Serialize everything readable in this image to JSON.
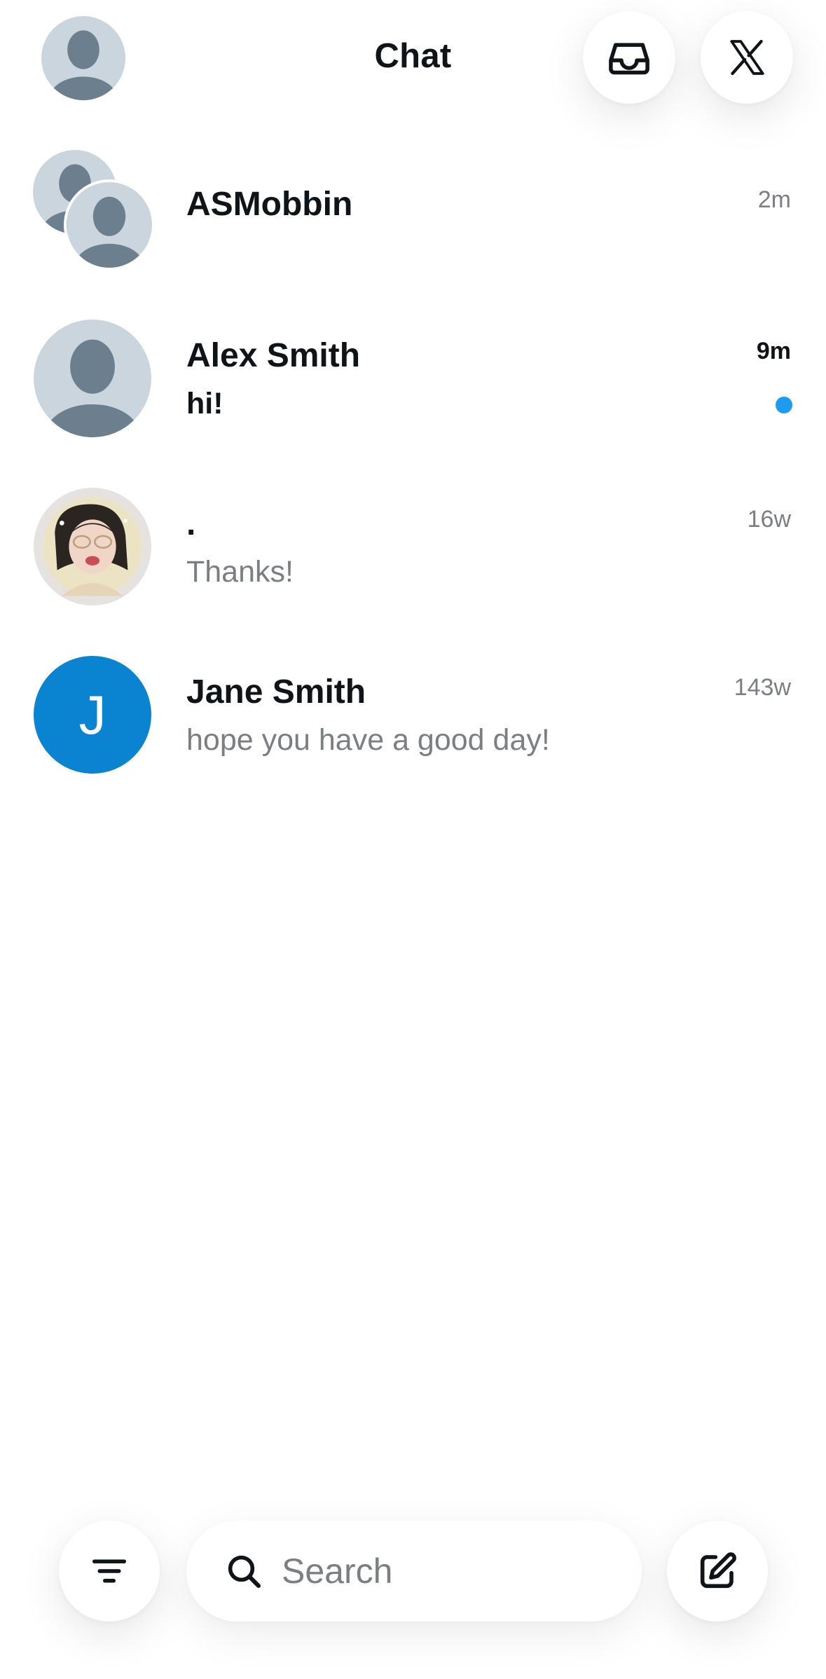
{
  "header": {
    "title": "Chat",
    "profile_icon": "default-avatar-icon",
    "inbox_icon": "inbox-tray-icon",
    "x_icon": "x-logo-icon"
  },
  "colors": {
    "unread_dot": "#1d9bf0",
    "avatar_bg": "#cbd5dd",
    "avatar_figure": "#6b7f8e",
    "jane_avatar": "#0a84d0"
  },
  "conversations": [
    {
      "name": "ASMobbin",
      "preview": "",
      "time": "2m",
      "unread": false,
      "avatar": "group-avatar"
    },
    {
      "name": "Alex Smith",
      "preview": "hi!",
      "time": "9m",
      "unread": true,
      "avatar": "default-avatar"
    },
    {
      "name": ".",
      "preview": "Thanks!",
      "time": "16w",
      "unread": false,
      "avatar": "photo-avatar"
    },
    {
      "name": "Jane Smith",
      "preview": "hope you have a good day!",
      "time": "143w",
      "unread": false,
      "avatar": "letter-avatar",
      "avatar_letter": "J"
    }
  ],
  "bottom": {
    "search_placeholder": "Search",
    "filter_icon": "filter-icon",
    "compose_icon": "compose-icon"
  }
}
